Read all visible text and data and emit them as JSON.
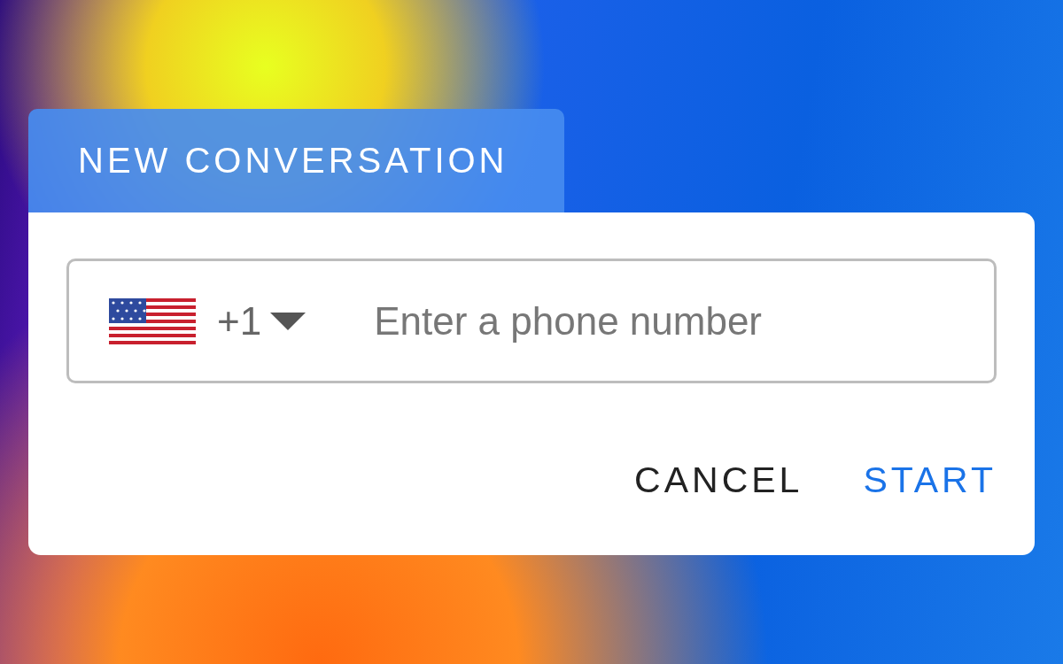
{
  "tab": {
    "label": "NEW CONVERSATION"
  },
  "phone_field": {
    "country_code": "+1",
    "placeholder": "Enter a phone number"
  },
  "buttons": [
    {
      "label": "CANCEL",
      "kind": "secondary"
    },
    {
      "label": "START",
      "kind": "primary"
    }
  ]
}
